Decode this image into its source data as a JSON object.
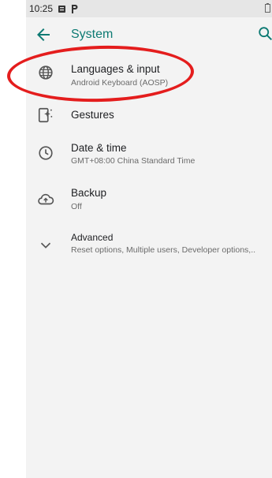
{
  "status_bar": {
    "time": "10:25"
  },
  "app_bar": {
    "title": "System"
  },
  "items": [
    {
      "title": "Languages & input",
      "summary": "Android Keyboard (AOSP)"
    },
    {
      "title": "Gestures"
    },
    {
      "title": "Date & time",
      "summary": "GMT+08:00 China Standard Time"
    },
    {
      "title": "Backup",
      "summary": "Off"
    },
    {
      "title": "Advanced",
      "summary": "Reset options, Multiple users, Developer options,.."
    }
  ],
  "colors": {
    "accent": "#0d7a73",
    "annotation": "#e41d1d",
    "background": "#f3f3f3",
    "status_bar": "#e6e6e6"
  },
  "icons": [
    "back-arrow-icon",
    "search-icon",
    "globe-icon",
    "gestures-icon",
    "clock-icon",
    "cloud-backup-icon",
    "chevron-down-icon"
  ]
}
